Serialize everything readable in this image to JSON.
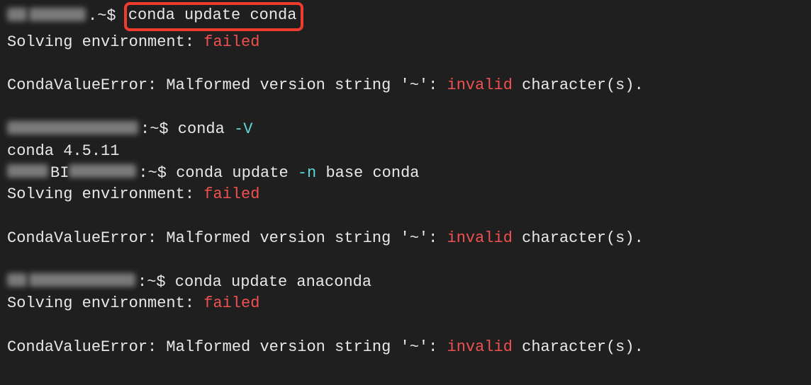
{
  "colors": {
    "bg": "#1f1f1f",
    "fg": "#e8e8e8",
    "error": "#f05050",
    "option": "#5fd7d7",
    "highlight_border": "#f03c2e"
  },
  "lines": [
    {
      "segments": [
        {
          "type": "blur",
          "w": "w1"
        },
        {
          "type": "blur",
          "w": "w6"
        },
        {
          "type": "text",
          "text": ".~$ "
        },
        {
          "type": "highlight_start"
        },
        {
          "type": "text",
          "text": "conda update conda"
        },
        {
          "type": "highlight_end"
        }
      ]
    },
    {
      "segments": [
        {
          "type": "text",
          "text": "Solving environment: "
        },
        {
          "type": "red",
          "text": "failed"
        }
      ]
    },
    {
      "segments": []
    },
    {
      "segments": [
        {
          "type": "text",
          "text": "CondaValueError: Malformed version string '~': "
        },
        {
          "type": "red",
          "text": "invalid"
        },
        {
          "type": "text",
          "text": " character(s)."
        }
      ]
    },
    {
      "segments": []
    },
    {
      "segments": [
        {
          "type": "blur",
          "w": "w4"
        },
        {
          "type": "text",
          "text": ":~$ conda "
        },
        {
          "type": "cyan",
          "text": "-V"
        }
      ]
    },
    {
      "segments": [
        {
          "type": "text",
          "text": "conda 4.5.11"
        }
      ]
    },
    {
      "segments": [
        {
          "type": "blur",
          "w": "w2"
        },
        {
          "type": "text",
          "text": "BI"
        },
        {
          "type": "blur",
          "w": "w7"
        },
        {
          "type": "text",
          "text": ":~$ conda update "
        },
        {
          "type": "cyan",
          "text": "-n"
        },
        {
          "type": "text",
          "text": " base conda"
        }
      ]
    },
    {
      "segments": [
        {
          "type": "text",
          "text": "Solving environment: "
        },
        {
          "type": "red",
          "text": "failed"
        }
      ]
    },
    {
      "segments": []
    },
    {
      "segments": [
        {
          "type": "text",
          "text": "CondaValueError: Malformed version string '~': "
        },
        {
          "type": "red",
          "text": "invalid"
        },
        {
          "type": "text",
          "text": " character(s)."
        }
      ]
    },
    {
      "segments": []
    },
    {
      "segments": [
        {
          "type": "blur",
          "w": "w1"
        },
        {
          "type": "blur",
          "w": "w3"
        },
        {
          "type": "text",
          "text": ":~$ conda update anaconda"
        }
      ]
    },
    {
      "segments": [
        {
          "type": "text",
          "text": "Solving environment: "
        },
        {
          "type": "red",
          "text": "failed"
        }
      ]
    },
    {
      "segments": []
    },
    {
      "segments": [
        {
          "type": "text",
          "text": "CondaValueError: Malformed version string '~': "
        },
        {
          "type": "red",
          "text": "invalid"
        },
        {
          "type": "text",
          "text": " character(s)."
        }
      ]
    }
  ]
}
